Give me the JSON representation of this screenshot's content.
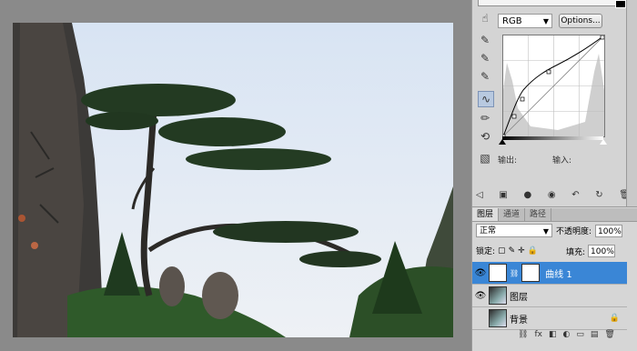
{
  "curves": {
    "channel": "RGB",
    "options_label": "Options...",
    "output_label": "输出:",
    "input_label": "输入:",
    "tools": [
      "adjust-icon",
      "eyedropper-black-icon",
      "eyedropper-gray-icon",
      "eyedropper-white-icon",
      "curve-point-icon",
      "pencil-icon",
      "smooth-icon"
    ],
    "bottom_icons": [
      "return-icon",
      "clip-icon",
      "view-icon",
      "eye-icon",
      "reset-icon",
      "refresh-icon",
      "trash-icon"
    ]
  },
  "layers": {
    "tabs": [
      "图层",
      "通道",
      "路径"
    ],
    "active_tab": "图层",
    "blend_mode": "正常",
    "opacity_label": "不透明度:",
    "opacity_value": "100%",
    "lock_label": "锁定:",
    "fill_label": "填充:",
    "fill_value": "100%",
    "items": [
      {
        "name": "曲线 1",
        "selected": true
      },
      {
        "name": "图层",
        "selected": false
      },
      {
        "name": "背景",
        "selected": false
      }
    ]
  },
  "colors": {
    "selection": "#3a86d6",
    "panel_bg": "#d6d6d6"
  }
}
